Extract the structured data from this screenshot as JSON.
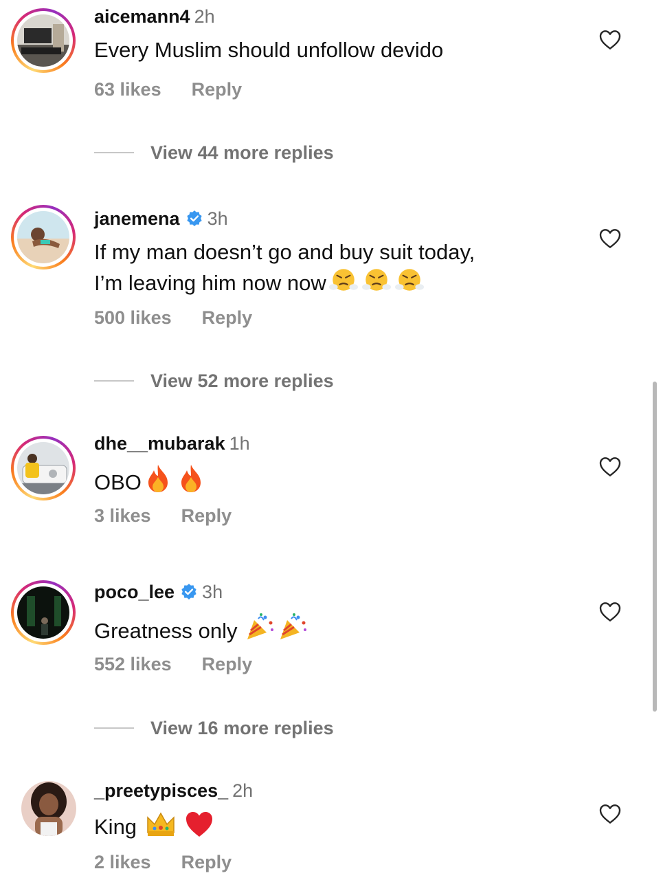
{
  "comments": [
    {
      "username": "aicemann4",
      "time": "2h",
      "verified": false,
      "text": "Every Muslim should unfollow devido",
      "text_line2": "",
      "likes": "63 likes",
      "reply": "Reply",
      "more_replies": "View 44 more replies"
    },
    {
      "username": "janemena",
      "time": "3h",
      "verified": true,
      "text": "If my man doesn’t go and buy suit today,",
      "text_line2": "I’m leaving him now now",
      "likes": "500 likes",
      "reply": "Reply",
      "more_replies": "View 52 more replies"
    },
    {
      "username": "dhe__mubarak",
      "time": "1h",
      "verified": false,
      "text": "OBO",
      "text_line2": "",
      "likes": "3 likes",
      "reply": "Reply",
      "more_replies": ""
    },
    {
      "username": "poco_lee",
      "time": "3h",
      "verified": true,
      "text": "Greatness only",
      "text_line2": "",
      "likes": "552 likes",
      "reply": "Reply",
      "more_replies": "View 16 more replies"
    },
    {
      "username": "_preetypisces_",
      "time": "2h",
      "verified": false,
      "text": "King",
      "text_line2": "",
      "likes": "2 likes",
      "reply": "Reply",
      "more_replies": ""
    }
  ],
  "icons": {
    "like": "heart-outline-icon",
    "verified": "verified-badge-icon",
    "angry": "face-with-steam-emoji",
    "fire": "fire-emoji",
    "party": "party-popper-emoji",
    "crown": "crown-emoji",
    "heart": "red-heart-emoji"
  },
  "colors": {
    "verified_blue": "#3897f0",
    "muted_text": "#8e8e8e",
    "story_ring": "#d62976"
  }
}
